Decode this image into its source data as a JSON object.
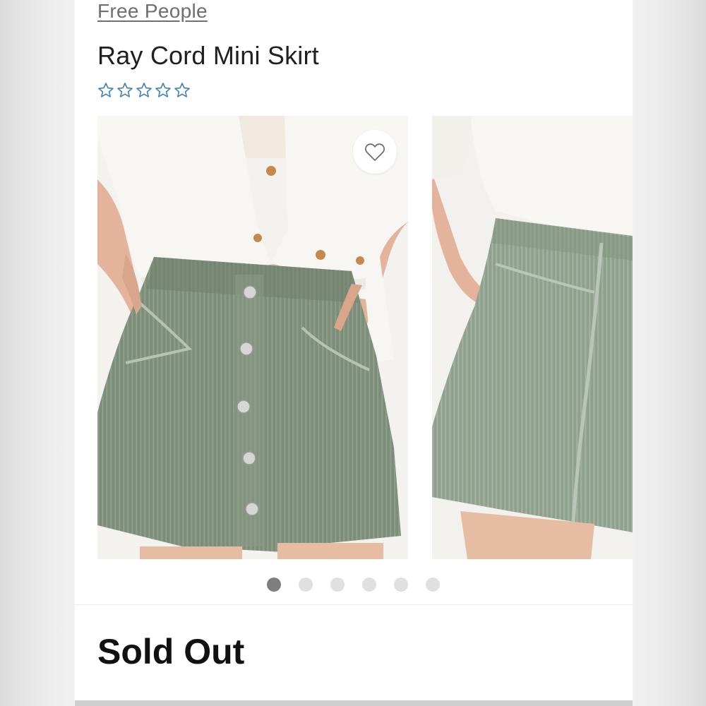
{
  "product": {
    "brand": "Free People",
    "title": "Ray Cord Mini Skirt",
    "rating": {
      "value": 0,
      "max": 5,
      "star_color": "#3f7fb3"
    },
    "status": "Sold Out"
  },
  "gallery": {
    "image_count": 6,
    "active_index": 0,
    "favorite_icon": "heart-outline-icon",
    "skirt_color": "#7c8d78",
    "shirt_color": "#f7f6f2"
  }
}
